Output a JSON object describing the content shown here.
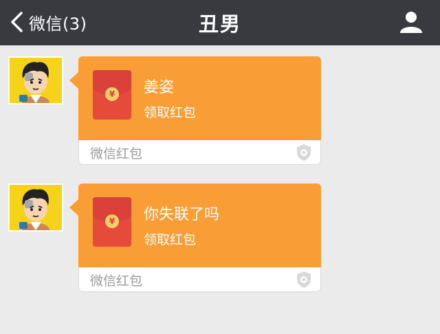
{
  "navbar": {
    "back_label": "微信(3)",
    "title": "丑男"
  },
  "messages": [
    {
      "title": "姜姿",
      "subtitle": "领取红包",
      "footer": "微信红包",
      "coin_symbol": "¥"
    },
    {
      "title": "你失联了吗",
      "subtitle": "领取红包",
      "footer": "微信红包",
      "coin_symbol": "¥"
    }
  ],
  "colors": {
    "navbar_bg": "#393a3f",
    "bubble_orange": "#f99e37",
    "envelope_red": "#e64a3b",
    "background": "#ebebeb"
  },
  "icons": [
    "back-chevron-icon",
    "profile-icon",
    "red-envelope-icon",
    "shield-icon",
    "avatar"
  ]
}
